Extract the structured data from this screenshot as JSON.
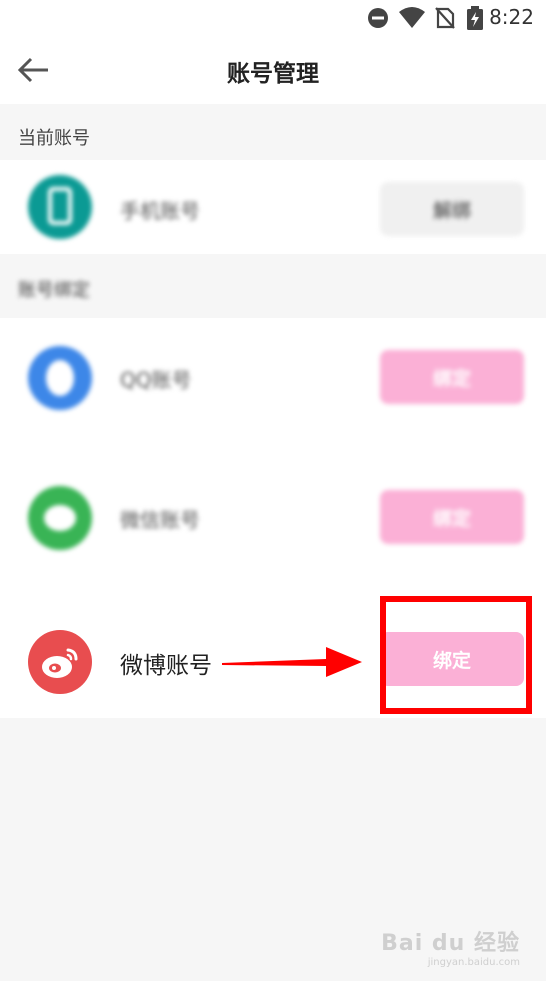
{
  "status_bar": {
    "time": "8:22",
    "icons": [
      "dnd-icon",
      "wifi-icon",
      "no-sim-icon",
      "battery-charging-icon"
    ]
  },
  "header": {
    "title": "账号管理",
    "back_icon": "arrow-left-icon"
  },
  "current_account": {
    "section_label": "当前账号",
    "name": "手机账号",
    "button_label": "解绑",
    "avatar_color": "#0b9a94"
  },
  "bound_accounts": {
    "section_label": "账号绑定",
    "items": [
      {
        "name": "QQ账号",
        "button_label": "绑定",
        "icon": "qq-icon",
        "avatar_color": "#3d87e8"
      },
      {
        "name": "微信账号",
        "button_label": "绑定",
        "icon": "wechat-icon",
        "avatar_color": "#39b455"
      },
      {
        "name": "微博账号",
        "button_label": "绑定",
        "icon": "weibo-icon",
        "avatar_color": "#e84d4f"
      }
    ]
  },
  "colors": {
    "accent_pink": "#fbb0d6",
    "annotation_red": "#ff0000"
  },
  "watermark": {
    "main": "Bai du 经验",
    "sub": "jingyan.baidu.com"
  }
}
